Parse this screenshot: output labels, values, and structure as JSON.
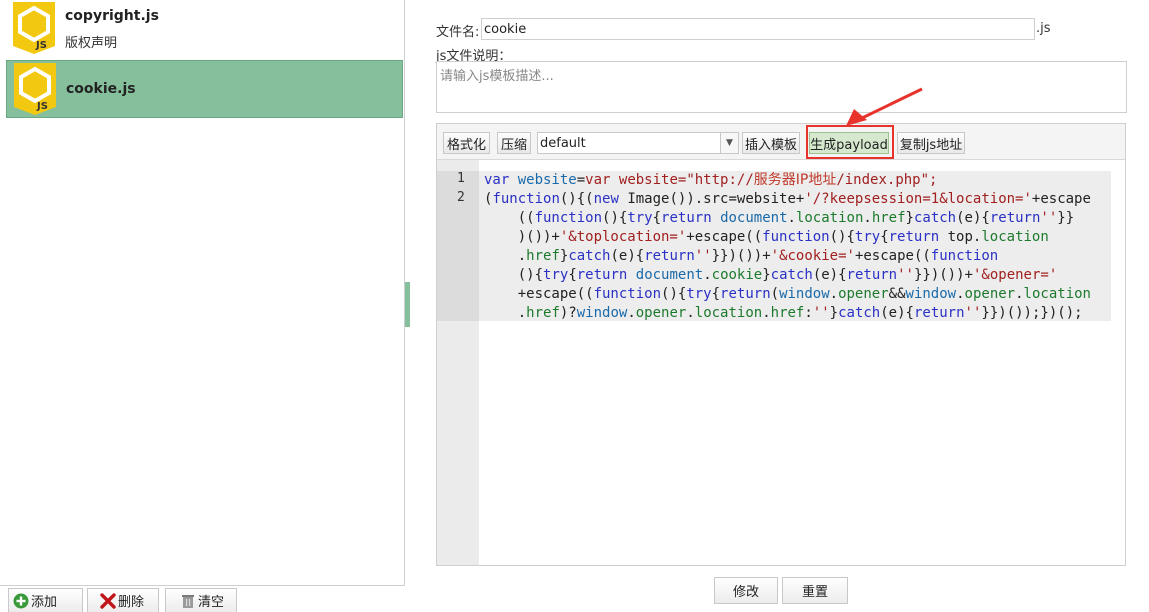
{
  "templates": [
    {
      "name": "copyright.js",
      "desc": "版权声明",
      "selected": false
    },
    {
      "name": "cookie.js",
      "desc": "",
      "selected": true
    }
  ],
  "bottom_buttons": {
    "add": "添加",
    "delete": "删除",
    "clear": "清空"
  },
  "form": {
    "filename_label": "文件名:",
    "filename_value": "cookie",
    "filename_ext": ".js",
    "desc_label": "js文件说明：",
    "desc_placeholder": "请输入js模板描述..."
  },
  "toolbar": {
    "format": "格式化",
    "compress": "压缩",
    "theme_selected": "default",
    "insert_template": "插入模板",
    "generate_payload": "生成payload",
    "copy_js_url": "复制js地址"
  },
  "code": {
    "line_numbers": [
      "1",
      "2"
    ],
    "line1_prefix": "var website=\"http://",
    "line1_mask": "服务器IP地址",
    "line1_suffix": "/index.php\";"
  },
  "footer": {
    "modify": "修改",
    "reset": "重置"
  },
  "colors": {
    "selected_bg": "#86bf9c",
    "highlight_border": "#e8322c",
    "js_icon": "#f2c811"
  }
}
